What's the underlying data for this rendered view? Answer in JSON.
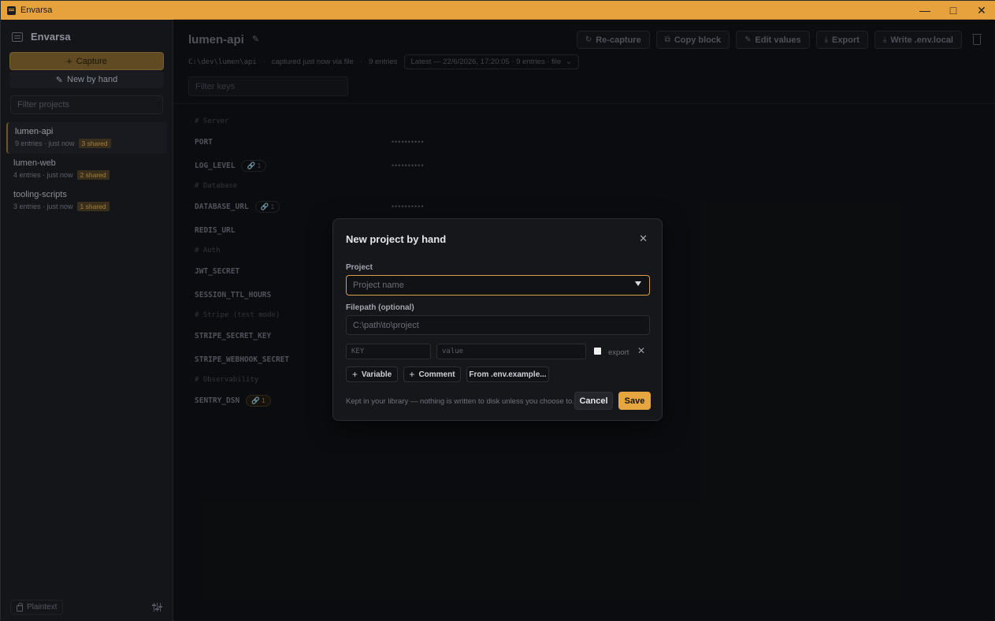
{
  "window": {
    "title": "Envarsa",
    "controls": [
      "minimize",
      "maximize",
      "close"
    ]
  },
  "sidebar": {
    "brand": "Envarsa",
    "capture_label": "Capture",
    "by_hand_label": "New by hand",
    "filter_placeholder": "Filter projects",
    "projects": [
      {
        "name": "lumen-api",
        "meta": "9 entries · just now",
        "badge": "3 shared",
        "active": true
      },
      {
        "name": "lumen-web",
        "meta": "4 entries · just now",
        "badge": "2 shared",
        "active": false
      },
      {
        "name": "tooling-scripts",
        "meta": "3 entries · just now",
        "badge": "1 shared",
        "active": false
      }
    ],
    "footer": {
      "mode_label": "Plaintext"
    }
  },
  "main": {
    "title": "lumen-api",
    "path": "C:\\dev\\lumen\\api",
    "captured": "captured just now via file",
    "entries_count": "9 entries",
    "version": "Latest — 22/6/2026, 17:20:05 · 9 entries · file",
    "toolbar": {
      "recapture": "Re-capture",
      "copy_block": "Copy block",
      "edit_values": "Edit values",
      "export": "Export",
      "write_env": "Write .env.local"
    },
    "filter_keys_placeholder": "Filter keys",
    "sections": [
      {
        "comment": "# Server",
        "entries": [
          {
            "key": "PORT",
            "link": "",
            "masked": "••••••••••"
          },
          {
            "key": "LOG_LEVEL",
            "link": "1",
            "masked": "••••••••••"
          }
        ]
      },
      {
        "comment": "# Database",
        "entries": [
          {
            "key": "DATABASE_URL",
            "link": "1",
            "masked": "••••••••••"
          },
          {
            "key": "REDIS_URL",
            "link": "",
            "masked": ""
          }
        ]
      },
      {
        "comment": "# Auth",
        "entries": [
          {
            "key": "JWT_SECRET",
            "link": "",
            "masked": ""
          },
          {
            "key": "SESSION_TTL_HOURS",
            "link": "",
            "masked": ""
          }
        ]
      },
      {
        "comment": "# Stripe (test mode)",
        "entries": [
          {
            "key": "STRIPE_SECRET_KEY",
            "link": "",
            "masked": ""
          },
          {
            "key": "STRIPE_WEBHOOK_SECRET",
            "link": "",
            "masked": ""
          }
        ]
      },
      {
        "comment": "# Observability",
        "entries": [
          {
            "key": "SENTRY_DSN",
            "link": "1",
            "masked": ""
          }
        ]
      }
    ]
  },
  "modal": {
    "title": "New project by hand",
    "project_label": "Project",
    "project_placeholder": "Project name",
    "filepath_label": "Filepath (optional)",
    "filepath_placeholder": "C:\\path\\to\\project",
    "key_placeholder": "KEY",
    "value_placeholder": "value",
    "export_label": "export",
    "add_variable": "Variable",
    "add_comment": "Comment",
    "from_example": "From .env.example...",
    "footnote": "Kept in your library — nothing is written to disk unless you choose to.",
    "cancel": "Cancel",
    "save": "Save"
  }
}
